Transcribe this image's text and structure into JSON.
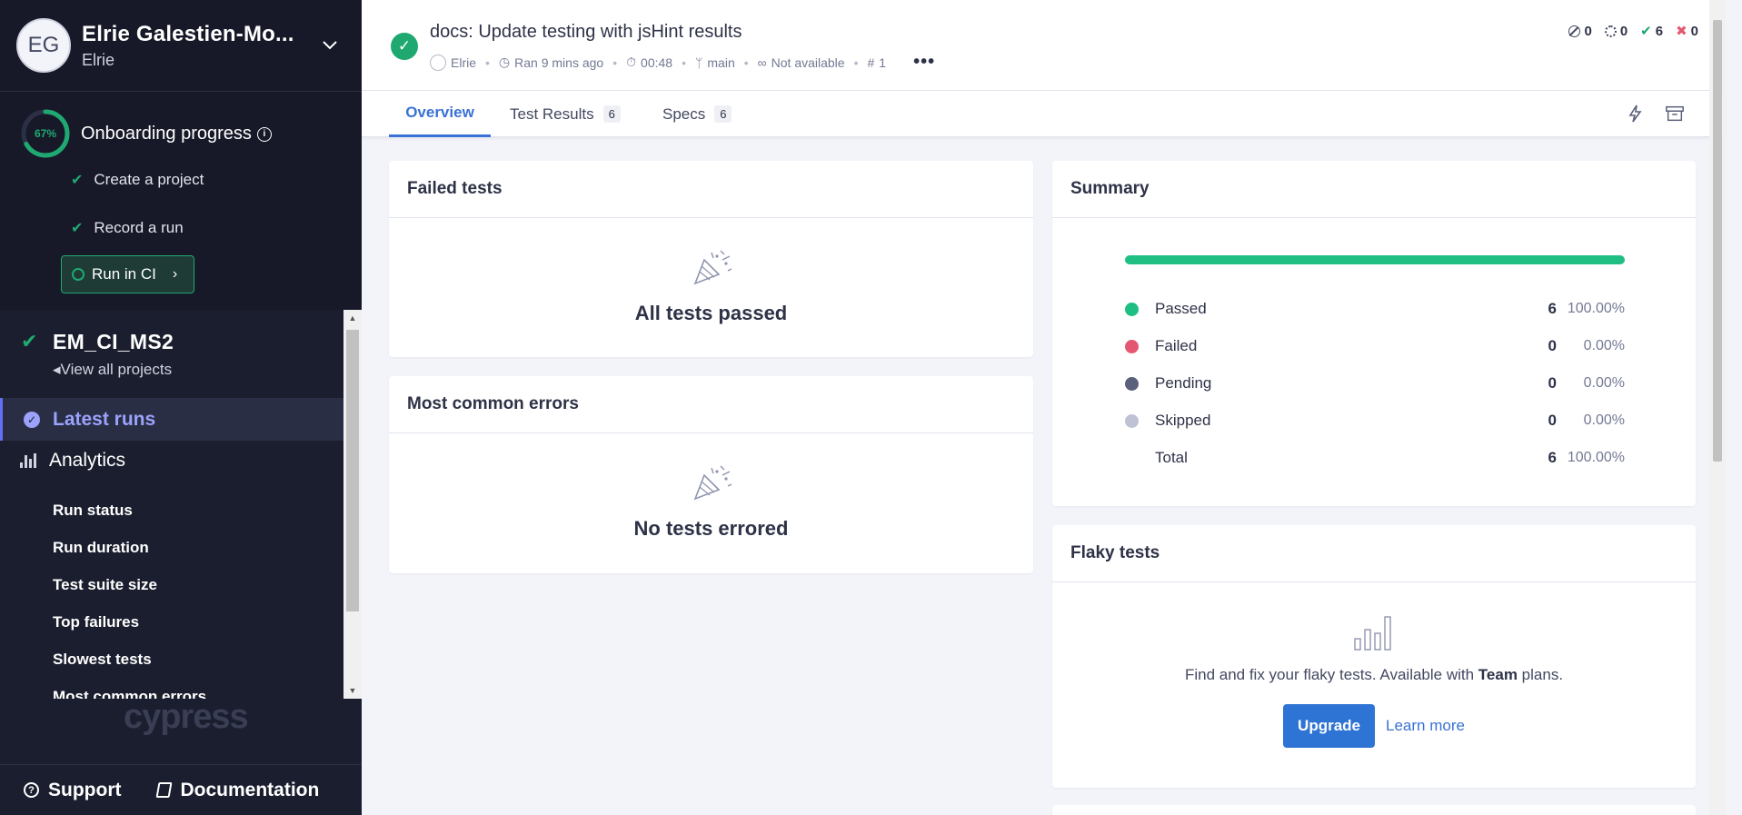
{
  "org": {
    "initials": "EG",
    "name": "Elrie Galestien-Mo...",
    "user": "Elrie"
  },
  "onboarding": {
    "percent": 0.67,
    "percent_label": "67%",
    "title": "Onboarding progress",
    "steps": [
      "Create a project",
      "Record a run"
    ],
    "cta": "Run in CI"
  },
  "project": {
    "name": "EM_CI_MS2",
    "view_all": "View all projects"
  },
  "nav": {
    "latest_runs": "Latest runs",
    "analytics": "Analytics",
    "analytics_items": [
      "Run status",
      "Run duration",
      "Test suite size",
      "Top failures",
      "Slowest tests",
      "Most common errors"
    ]
  },
  "brand": "cypress",
  "footer": {
    "support": "Support",
    "documentation": "Documentation"
  },
  "run": {
    "title": "docs: Update testing with jsHint results",
    "author": "Elrie",
    "ran": "Ran 9 mins ago",
    "duration": "00:48",
    "branch": "main",
    "ci": "Not available",
    "number": "1",
    "counts": {
      "skipped": "0",
      "pending": "0",
      "passed": "6",
      "failed": "0"
    }
  },
  "tabs": [
    {
      "label": "Overview",
      "count": ""
    },
    {
      "label": "Test Results",
      "count": "6"
    },
    {
      "label": "Specs",
      "count": "6"
    }
  ],
  "failed_tests": {
    "title": "Failed tests",
    "empty": "All tests passed"
  },
  "common_errors": {
    "title": "Most common errors",
    "empty": "No tests errored"
  },
  "summary": {
    "title": "Summary",
    "rows": [
      {
        "label": "Passed",
        "count": "6",
        "pct": "100.00%",
        "color": "#1fbf84"
      },
      {
        "label": "Failed",
        "count": "0",
        "pct": "0.00%",
        "color": "#e45770"
      },
      {
        "label": "Pending",
        "count": "0",
        "pct": "0.00%",
        "color": "#5a5f7a"
      },
      {
        "label": "Skipped",
        "count": "0",
        "pct": "0.00%",
        "color": "#bfc2d4"
      },
      {
        "label": "Total",
        "count": "6",
        "pct": "100.00%",
        "color": ""
      }
    ]
  },
  "flaky": {
    "title": "Flaky tests",
    "text_before": "Find and fix your flaky tests. Available with ",
    "text_bold": "Team",
    "text_after": " plans.",
    "upgrade": "Upgrade",
    "learn_more": "Learn more"
  }
}
